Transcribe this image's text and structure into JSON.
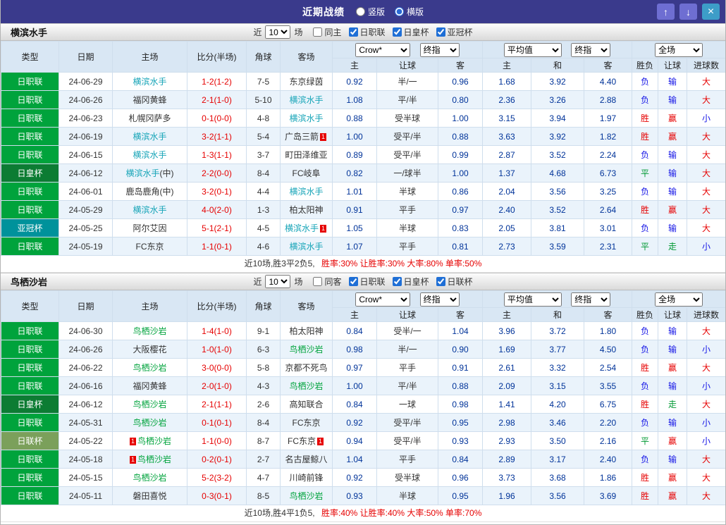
{
  "titlebar": {
    "title": "近期战绩",
    "layout_radios": [
      {
        "label": "竖版",
        "checked": false
      },
      {
        "label": "横版",
        "checked": true
      }
    ],
    "icons": {
      "up": "↑",
      "down": "↓",
      "close": "×"
    }
  },
  "filter_labels": {
    "near": "近",
    "games": "场"
  },
  "table_header": {
    "cols": [
      "类型",
      "日期",
      "主场",
      "比分(半场)",
      "角球",
      "客场"
    ],
    "g1_select1": "Crow*",
    "g1_select2": "终指",
    "g1_subs": [
      "主",
      "让球",
      "客"
    ],
    "g2_select1": "平均值",
    "g2_select2": "终指",
    "g2_subs": [
      "主",
      "和",
      "客"
    ],
    "g3_select1": "全场",
    "g3_subs": [
      "胜负",
      "让球",
      "进球数"
    ]
  },
  "league_colors": {
    "日职联": "#00a33c",
    "日皇杯": "#0c7c33",
    "亚冠杯": "#00929b",
    "日联杯": "#7ba05b"
  },
  "result_colors": {
    "r": "#e60000",
    "b": "#1414e6",
    "g": "#009933"
  },
  "sections": [
    {
      "team": "横滨水手",
      "focus_color": "#18a5b8",
      "filter": {
        "count": "10",
        "checkboxes": [
          {
            "label": "同主",
            "checked": false
          },
          {
            "label": "日职联",
            "checked": true
          },
          {
            "label": "日皇杯",
            "checked": true
          },
          {
            "label": "亚冠杯",
            "checked": true
          }
        ]
      },
      "rows": [
        {
          "league": "日职联",
          "date": "24-06-29",
          "home": {
            "name": "横滨水手",
            "focus": true
          },
          "score": "1-2(1-2)",
          "corners": "7-5",
          "away": {
            "name": "东京绿茵"
          },
          "odds": [
            "0.92",
            "半/一",
            "0.96",
            "1.68",
            "3.92",
            "4.40"
          ],
          "res": [
            [
              "负",
              "b"
            ],
            [
              "输",
              "b"
            ],
            [
              "大",
              "r"
            ]
          ]
        },
        {
          "league": "日职联",
          "date": "24-06-26",
          "home": {
            "name": "福冈黄蜂"
          },
          "score": "2-1(1-0)",
          "corners": "5-10",
          "away": {
            "name": "横滨水手",
            "focus": true
          },
          "odds": [
            "1.08",
            "平/半",
            "0.80",
            "2.36",
            "3.26",
            "2.88"
          ],
          "res": [
            [
              "负",
              "b"
            ],
            [
              "输",
              "b"
            ],
            [
              "大",
              "r"
            ]
          ]
        },
        {
          "league": "日职联",
          "date": "24-06-23",
          "home": {
            "name": "札幌冈萨多"
          },
          "score": "0-1(0-0)",
          "corners": "4-8",
          "away": {
            "name": "横滨水手",
            "focus": true
          },
          "odds": [
            "0.88",
            "受半球",
            "1.00",
            "3.15",
            "3.94",
            "1.97"
          ],
          "res": [
            [
              "胜",
              "r"
            ],
            [
              "赢",
              "r"
            ],
            [
              "小",
              "b"
            ]
          ]
        },
        {
          "league": "日职联",
          "date": "24-06-19",
          "home": {
            "name": "横滨水手",
            "focus": true
          },
          "score": "3-2(1-1)",
          "corners": "5-4",
          "away": {
            "name": "广岛三箭",
            "card_post": "1"
          },
          "odds": [
            "1.00",
            "受平/半",
            "0.88",
            "3.63",
            "3.92",
            "1.82"
          ],
          "res": [
            [
              "胜",
              "r"
            ],
            [
              "赢",
              "r"
            ],
            [
              "大",
              "r"
            ]
          ]
        },
        {
          "league": "日职联",
          "date": "24-06-15",
          "home": {
            "name": "横滨水手",
            "focus": true
          },
          "score": "1-3(1-1)",
          "corners": "3-7",
          "away": {
            "name": "町田泽维亚"
          },
          "odds": [
            "0.89",
            "受平/半",
            "0.99",
            "2.87",
            "3.52",
            "2.24"
          ],
          "res": [
            [
              "负",
              "b"
            ],
            [
              "输",
              "b"
            ],
            [
              "大",
              "r"
            ]
          ]
        },
        {
          "league": "日皇杯",
          "date": "24-06-12",
          "home": {
            "name": "横滨水手",
            "suffix": "(中)",
            "focus": true
          },
          "score": "2-2(0-0)",
          "corners": "8-4",
          "away": {
            "name": "FC岐阜"
          },
          "odds": [
            "0.82",
            "一/球半",
            "1.00",
            "1.37",
            "4.68",
            "6.73"
          ],
          "res": [
            [
              "平",
              "g"
            ],
            [
              "输",
              "b"
            ],
            [
              "大",
              "r"
            ]
          ]
        },
        {
          "league": "日职联",
          "date": "24-06-01",
          "home": {
            "name": "鹿岛鹿角",
            "suffix": "(中)"
          },
          "score": "3-2(0-1)",
          "corners": "4-4",
          "away": {
            "name": "横滨水手",
            "focus": true
          },
          "odds": [
            "1.01",
            "半球",
            "0.86",
            "2.04",
            "3.56",
            "3.25"
          ],
          "res": [
            [
              "负",
              "b"
            ],
            [
              "输",
              "b"
            ],
            [
              "大",
              "r"
            ]
          ]
        },
        {
          "league": "日职联",
          "date": "24-05-29",
          "home": {
            "name": "横滨水手",
            "focus": true
          },
          "score": "4-0(2-0)",
          "corners": "1-3",
          "away": {
            "name": "柏太阳神"
          },
          "odds": [
            "0.91",
            "平手",
            "0.97",
            "2.40",
            "3.52",
            "2.64"
          ],
          "res": [
            [
              "胜",
              "r"
            ],
            [
              "赢",
              "r"
            ],
            [
              "大",
              "r"
            ]
          ]
        },
        {
          "league": "亚冠杯",
          "date": "24-05-25",
          "home": {
            "name": "阿尔艾因"
          },
          "score": "5-1(2-1)",
          "corners": "4-5",
          "away": {
            "name": "横滨水手",
            "focus": true,
            "card_post": "1"
          },
          "odds": [
            "1.05",
            "半球",
            "0.83",
            "2.05",
            "3.81",
            "3.01"
          ],
          "res": [
            [
              "负",
              "b"
            ],
            [
              "输",
              "b"
            ],
            [
              "大",
              "r"
            ]
          ]
        },
        {
          "league": "日职联",
          "date": "24-05-19",
          "home": {
            "name": "FC东京"
          },
          "score": "1-1(0-1)",
          "corners": "4-6",
          "away": {
            "name": "横滨水手",
            "focus": true
          },
          "odds": [
            "1.07",
            "平手",
            "0.81",
            "2.73",
            "3.59",
            "2.31"
          ],
          "res": [
            [
              "平",
              "g"
            ],
            [
              "走",
              "g"
            ],
            [
              "小",
              "b"
            ]
          ]
        }
      ],
      "summary_prefix": "近10场,胜3平2负5,",
      "summary_rates": "胜率:30% 让胜率:30% 大率:80% 单率:50%"
    },
    {
      "team": "鸟栖沙岩",
      "focus_color": "#00a33c",
      "filter": {
        "count": "10",
        "checkboxes": [
          {
            "label": "同客",
            "checked": false
          },
          {
            "label": "日职联",
            "checked": true
          },
          {
            "label": "日皇杯",
            "checked": true
          },
          {
            "label": "日联杯",
            "checked": true
          }
        ]
      },
      "rows": [
        {
          "league": "日职联",
          "date": "24-06-30",
          "home": {
            "name": "鸟栖沙岩",
            "focus": true
          },
          "score": "1-4(1-0)",
          "corners": "9-1",
          "away": {
            "name": "柏太阳神"
          },
          "odds": [
            "0.84",
            "受半/一",
            "1.04",
            "3.96",
            "3.72",
            "1.80"
          ],
          "res": [
            [
              "负",
              "b"
            ],
            [
              "输",
              "b"
            ],
            [
              "大",
              "r"
            ]
          ]
        },
        {
          "league": "日职联",
          "date": "24-06-26",
          "home": {
            "name": "大阪樱花"
          },
          "score": "1-0(1-0)",
          "corners": "6-3",
          "away": {
            "name": "鸟栖沙岩",
            "focus": true
          },
          "odds": [
            "0.98",
            "半/一",
            "0.90",
            "1.69",
            "3.77",
            "4.50"
          ],
          "res": [
            [
              "负",
              "b"
            ],
            [
              "输",
              "b"
            ],
            [
              "小",
              "b"
            ]
          ]
        },
        {
          "league": "日职联",
          "date": "24-06-22",
          "home": {
            "name": "鸟栖沙岩",
            "focus": true
          },
          "score": "3-0(0-0)",
          "corners": "5-8",
          "away": {
            "name": "京都不死鸟"
          },
          "odds": [
            "0.97",
            "平手",
            "0.91",
            "2.61",
            "3.32",
            "2.54"
          ],
          "res": [
            [
              "胜",
              "r"
            ],
            [
              "赢",
              "r"
            ],
            [
              "大",
              "r"
            ]
          ]
        },
        {
          "league": "日职联",
          "date": "24-06-16",
          "home": {
            "name": "福冈黄蜂"
          },
          "score": "2-0(1-0)",
          "corners": "4-3",
          "away": {
            "name": "鸟栖沙岩",
            "focus": true
          },
          "odds": [
            "1.00",
            "平/半",
            "0.88",
            "2.09",
            "3.15",
            "3.55"
          ],
          "res": [
            [
              "负",
              "b"
            ],
            [
              "输",
              "b"
            ],
            [
              "小",
              "b"
            ]
          ]
        },
        {
          "league": "日皇杯",
          "date": "24-06-12",
          "home": {
            "name": "鸟栖沙岩",
            "focus": true
          },
          "score": "2-1(1-1)",
          "corners": "2-6",
          "away": {
            "name": "高知联合"
          },
          "odds": [
            "0.84",
            "一球",
            "0.98",
            "1.41",
            "4.20",
            "6.75"
          ],
          "res": [
            [
              "胜",
              "r"
            ],
            [
              "走",
              "g"
            ],
            [
              "大",
              "r"
            ]
          ]
        },
        {
          "league": "日职联",
          "date": "24-05-31",
          "home": {
            "name": "鸟栖沙岩",
            "focus": true
          },
          "score": "0-1(0-1)",
          "corners": "8-4",
          "away": {
            "name": "FC东京"
          },
          "odds": [
            "0.92",
            "受平/半",
            "0.95",
            "2.98",
            "3.46",
            "2.20"
          ],
          "res": [
            [
              "负",
              "b"
            ],
            [
              "输",
              "b"
            ],
            [
              "小",
              "b"
            ]
          ]
        },
        {
          "league": "日联杯",
          "date": "24-05-22",
          "home": {
            "name": "鸟栖沙岩",
            "focus": true,
            "card_pre": "1"
          },
          "score": "1-1(0-0)",
          "corners": "8-7",
          "away": {
            "name": "FC东京",
            "card_post": "1"
          },
          "odds": [
            "0.94",
            "受平/半",
            "0.93",
            "2.93",
            "3.50",
            "2.16"
          ],
          "res": [
            [
              "平",
              "g"
            ],
            [
              "赢",
              "r"
            ],
            [
              "小",
              "b"
            ]
          ]
        },
        {
          "league": "日职联",
          "date": "24-05-18",
          "home": {
            "name": "鸟栖沙岩",
            "focus": true,
            "card_pre": "1"
          },
          "score": "0-2(0-1)",
          "corners": "2-7",
          "away": {
            "name": "名古屋鲸八"
          },
          "odds": [
            "1.04",
            "平手",
            "0.84",
            "2.89",
            "3.17",
            "2.40"
          ],
          "res": [
            [
              "负",
              "b"
            ],
            [
              "输",
              "b"
            ],
            [
              "大",
              "r"
            ]
          ]
        },
        {
          "league": "日职联",
          "date": "24-05-15",
          "home": {
            "name": "鸟栖沙岩",
            "focus": true
          },
          "score": "5-2(3-2)",
          "corners": "4-7",
          "away": {
            "name": "川崎前锋"
          },
          "odds": [
            "0.92",
            "受半球",
            "0.96",
            "3.73",
            "3.68",
            "1.86"
          ],
          "res": [
            [
              "胜",
              "r"
            ],
            [
              "赢",
              "r"
            ],
            [
              "大",
              "r"
            ]
          ]
        },
        {
          "league": "日职联",
          "date": "24-05-11",
          "home": {
            "name": "磐田喜悦"
          },
          "score": "0-3(0-1)",
          "corners": "8-5",
          "away": {
            "name": "鸟栖沙岩",
            "focus": true
          },
          "odds": [
            "0.93",
            "半球",
            "0.95",
            "1.96",
            "3.56",
            "3.69"
          ],
          "res": [
            [
              "胜",
              "r"
            ],
            [
              "赢",
              "r"
            ],
            [
              "大",
              "r"
            ]
          ]
        }
      ],
      "summary_prefix": "近10场,胜4平1负5,",
      "summary_rates": "胜率:40% 让胜率:40% 大率:50% 单率:70%"
    }
  ]
}
